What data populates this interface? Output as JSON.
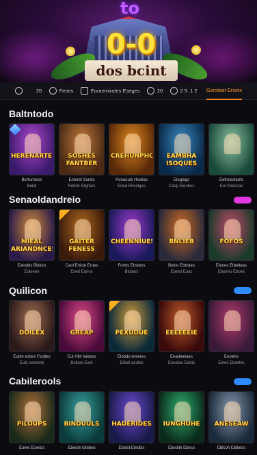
{
  "hero": {
    "logo": "to",
    "score": "0-0",
    "banner_text": "dos bcint"
  },
  "nav": {
    "items": [
      {
        "label": "",
        "icon": "search-icon"
      },
      {
        "label": "20",
        "icon": "dice-icon"
      },
      {
        "label": "Fenes",
        "icon": "chip-icon"
      },
      {
        "label": "Eoraemirates Eseges",
        "icon": "cards-icon"
      },
      {
        "label": "20",
        "icon": "clock-icon"
      },
      {
        "label": "2 9 .1 2",
        "icon": "star-icon"
      },
      {
        "label": "Gorstaot Ersets",
        "icon": "",
        "active": true
      }
    ]
  },
  "sections": [
    {
      "title": "Baltntodo",
      "pill": "",
      "cards": [
        {
          "title": "HERENARTES",
          "name": "Bertuniiess",
          "sub": "Belat",
          "art": "bank",
          "badge": "gem"
        },
        {
          "title": "SOSHES FANTBER",
          "name": "Entoret Sorels",
          "sub": "Rebler Etgriars",
          "art": "agent"
        },
        {
          "title": "CREHUNPHO",
          "name": "Ponuuuts Hisolas",
          "sub": "Eded Eheolges",
          "art": "gold"
        },
        {
          "title": "EAMBHA ISOQUES",
          "name": "Eleglogs",
          "sub": "Caop Eleobes",
          "art": "city"
        },
        {
          "title": "",
          "name": "Eetroiesterits",
          "sub": "Eol Stieonas",
          "art": "woman"
        }
      ]
    },
    {
      "title": "Senaoldandreio",
      "pill": "",
      "pill_color": "#e03ae0",
      "cards": [
        {
          "title": "MIEAL ARIANDNCES",
          "name": "Ealodds Bildors",
          "sub": "Eoloeen",
          "art": "castle"
        },
        {
          "title": "GAITER FENESS",
          "name": "Caol Enicie Erues",
          "sub": "Ebeit Eonos",
          "art": "vault",
          "badge": "ribbon"
        },
        {
          "title": "CHEENNIUES",
          "name": "Fomts Ebstens",
          "sub": "Bioliars",
          "art": "portal"
        },
        {
          "title": "BNLIEB",
          "name": "Boloo Ebbstes",
          "sub": "Ebelsi Eoas",
          "art": "sun"
        },
        {
          "title": "FOFOS",
          "name": "Eleoes Etbelteas",
          "sub": "Eboeno Eboes",
          "art": "joker"
        }
      ]
    },
    {
      "title": "Quilicon",
      "pill": "",
      "pill_color": "#2f8bff",
      "cards": [
        {
          "title": "DOILEX",
          "name": "Euble esbes Flodtes",
          "sub": "Eubl sebelets",
          "art": "woman2"
        },
        {
          "title": "GREAP",
          "name": "Eut Hllit Ioiebes",
          "sub": "Bolove Eeet",
          "art": "neon"
        },
        {
          "title": "PEXUDUE",
          "name": "Elobdo iesleres",
          "sub": "Elbotl aeoles",
          "art": "temple",
          "badge": "ribbon"
        },
        {
          "title": "EEEEEEIE",
          "name": "Eeadieeiaes",
          "sub": "Eeeaieo Edets",
          "art": "queen"
        },
        {
          "title": "",
          "name": "Eeslelts",
          "sub": "Eeles Ebeeles",
          "art": "dancer"
        }
      ]
    },
    {
      "title": "Cabilerools",
      "pill": "",
      "pill_color": "#2f8bff",
      "cards": [
        {
          "title": "PILOUPS",
          "name": "Eoele Etoelos",
          "sub": "",
          "art": "gnome"
        },
        {
          "title": "BINDUULS",
          "name": "Ebeote Iotebes",
          "sub": "",
          "art": "ruins"
        },
        {
          "title": "HADERIDES",
          "name": "Ebolst Eleobls",
          "sub": "",
          "art": "magic"
        },
        {
          "title": "IUNGHUHE",
          "name": "Ebeolte Ebecs",
          "sub": "",
          "art": "portal2"
        },
        {
          "title": "ANESEAW",
          "name": "Eblcoh Eblbess",
          "sub": "",
          "art": "viking"
        }
      ]
    }
  ],
  "art_colors": {
    "bank": [
      "#3a1a6a",
      "#b048d0"
    ],
    "agent": [
      "#4a2a14",
      "#c07a3a"
    ],
    "gold": [
      "#5a2a08",
      "#e08a20"
    ],
    "city": [
      "#0a2a4a",
      "#3a8ac0"
    ],
    "woman": [
      "#1a4a3a",
      "#8ac0a0"
    ],
    "castle": [
      "#2a1a4a",
      "#d08a3a"
    ],
    "vault": [
      "#3a1a0a",
      "#b06a20"
    ],
    "portal": [
      "#1a1a5a",
      "#a03ad0"
    ],
    "sun": [
      "#2a2a3a",
      "#d06a20"
    ],
    "joker": [
      "#1a3a2a",
      "#c04a6a"
    ],
    "woman2": [
      "#2a1a1a",
      "#a06a50"
    ],
    "neon": [
      "#4a0a3a",
      "#e04a8a"
    ],
    "temple": [
      "#0a2a3a",
      "#d09a3a"
    ],
    "queen": [
      "#3a0a0a",
      "#c05a2a"
    ],
    "dancer": [
      "#3a1a3a",
      "#b03a6a"
    ],
    "gnome": [
      "#1a2a1a",
      "#b0703a"
    ],
    "ruins": [
      "#0a3a3a",
      "#3aa0a0"
    ],
    "magic": [
      "#1a1a4a",
      "#6a4ad0"
    ],
    "portal2": [
      "#0a2a1a",
      "#30b070"
    ],
    "viking": [
      "#1a2a3a",
      "#8a9ab0"
    ]
  }
}
